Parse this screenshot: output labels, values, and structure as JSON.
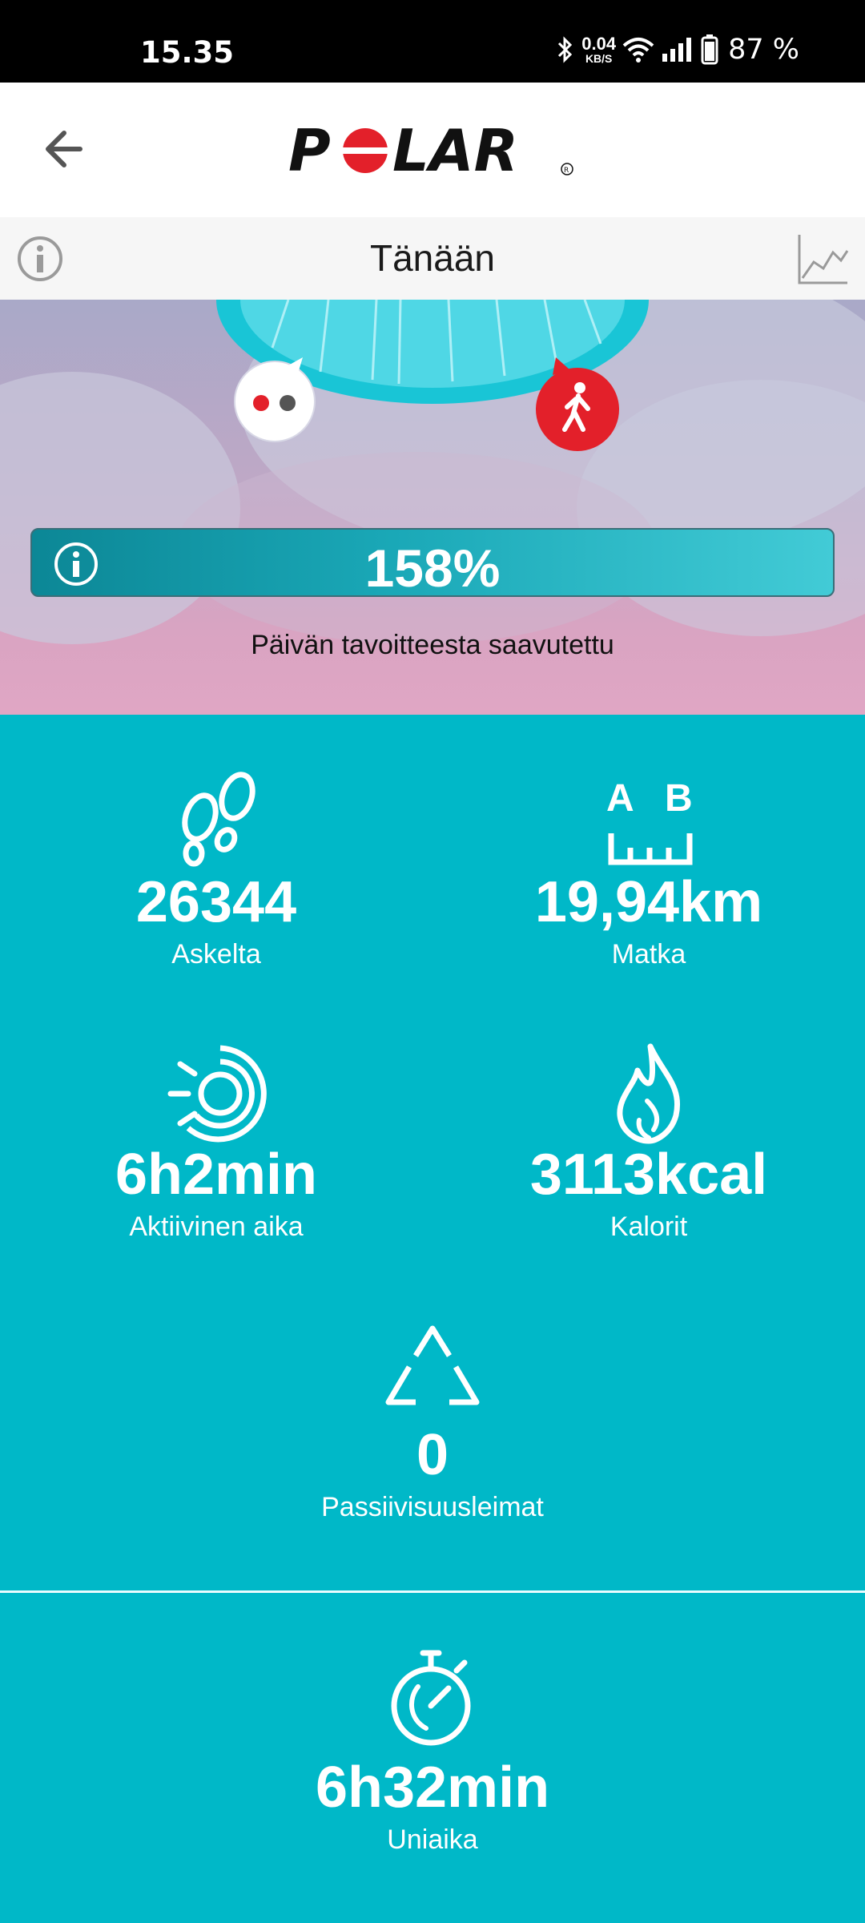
{
  "status_bar": {
    "time": "15.35",
    "net_speed": "0.04",
    "net_unit": "KB/S",
    "battery": "87 %",
    "icons": [
      "bluetooth-icon",
      "wifi-icon",
      "signal-icon",
      "battery-icon"
    ]
  },
  "header": {
    "logo_text": "POLAR",
    "logo_color": "#e3202a"
  },
  "subheader": {
    "title": "Tänään",
    "icons": [
      "info-icon",
      "trend-chart-icon"
    ]
  },
  "activity": {
    "progress_percent": "158%",
    "progress_value": 1.58,
    "goal_label": "Päivän tavoitteesta saavutettu"
  },
  "stats": {
    "steps": {
      "value": "26344",
      "label": "Askelta",
      "icon": "footsteps-icon"
    },
    "distance": {
      "value": "19,94km",
      "label": "Matka",
      "icon": "distance-ruler-icon",
      "point_a": "A",
      "point_b": "B"
    },
    "active_time": {
      "value": "6h2min",
      "label": "Aktiivinen aika",
      "icon": "active-time-icon"
    },
    "calories": {
      "value": "3113kcal",
      "label": "Kalorit",
      "icon": "flame-icon"
    },
    "inactivity": {
      "value": "0",
      "label": "Passiivisuusleimat",
      "icon": "inactivity-stamp-icon"
    },
    "sleep": {
      "value": "6h32min",
      "label": "Uniaika",
      "icon": "stopwatch-icon"
    }
  },
  "colors": {
    "accent_teal": "#00b8c8",
    "polar_red": "#e3202a"
  }
}
